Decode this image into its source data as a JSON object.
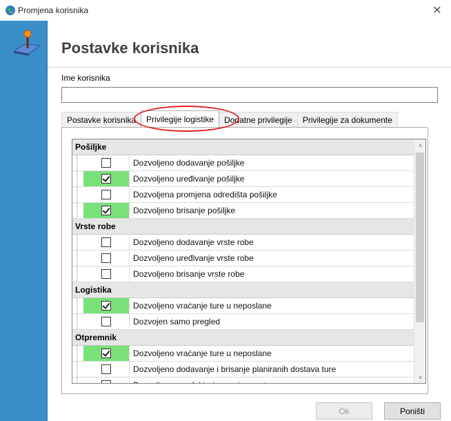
{
  "window": {
    "title": "Promjena korisnika",
    "close_glyph": "✕"
  },
  "header": {
    "title": "Postavke korisnika"
  },
  "form": {
    "name_label": "Ime korisnika",
    "name_value": ""
  },
  "tabs": [
    {
      "label": "Postavke korisnika",
      "active": false
    },
    {
      "label": "Privilegije logistike",
      "active": true
    },
    {
      "label": "Dodatne privilegije",
      "active": false
    },
    {
      "label": "Privilegije za dokumente",
      "active": false
    }
  ],
  "grid": {
    "groups": [
      {
        "name": "Pošiljke",
        "items": [
          {
            "label": "Dozvoljeno dodavanje pošiljke",
            "checked": false
          },
          {
            "label": "Dozvoljeno uređivanje pošiljke",
            "checked": true
          },
          {
            "label": "Dozvoljena promjena odredišta pošiljke",
            "checked": false
          },
          {
            "label": "Dozvoljeno brisanje pošiljke",
            "checked": true
          }
        ]
      },
      {
        "name": "Vrste robe",
        "items": [
          {
            "label": "Dozvoljeno dodavanje vrste robe",
            "checked": false
          },
          {
            "label": "Dozvoljeno uređivanje vrste robe",
            "checked": false
          },
          {
            "label": "Dozvoljeno brisanje vrste robe",
            "checked": false
          }
        ]
      },
      {
        "name": "Logistika",
        "items": [
          {
            "label": "Dozvoljeno vraćanje ture u neposlane",
            "checked": true
          },
          {
            "label": "Dozvojen samo pregled",
            "checked": false
          }
        ]
      },
      {
        "name": "Otpremnik",
        "items": [
          {
            "label": "Dozvoljeno vraćanje ture u neposlane",
            "checked": true
          },
          {
            "label": "Dozvoljeno dodavanje i brisanje planiranih dostava ture",
            "checked": false
          },
          {
            "label": "Dozvoljen unos fakturiranog iznosa ture",
            "checked": false
          }
        ]
      }
    ],
    "scroll_up": "˄",
    "scroll_down": "˅"
  },
  "buttons": {
    "ok": "Ok",
    "cancel": "Poništi"
  },
  "colors": {
    "checked_bg": "#79e07a",
    "sidebar": "#3a8fc8",
    "highlight": "#e02020"
  }
}
